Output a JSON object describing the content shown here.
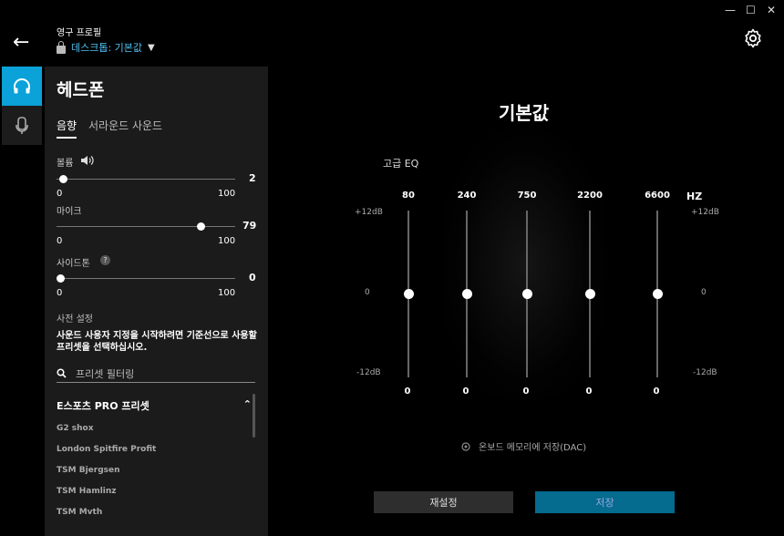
{
  "window": {
    "minimize": "—",
    "maximize": "☐",
    "close": "✕"
  },
  "header": {
    "back": "←",
    "profile_label": "영구 프로필",
    "profile_name": "데스크톱: 기본값"
  },
  "panel": {
    "title": "헤드폰",
    "tabs": [
      {
        "label": "음향",
        "active": true
      },
      {
        "label": "서라운드 사운드",
        "active": false
      }
    ],
    "sliders": [
      {
        "label": "볼륨",
        "value": "2",
        "fraction": 0.02,
        "min": "0",
        "max": "100"
      },
      {
        "label": "마이크",
        "value": "79",
        "fraction": 0.79,
        "min": "0",
        "max": "100"
      },
      {
        "label": "사이드톤",
        "value": "0",
        "fraction": 0.0,
        "min": "0",
        "max": "100",
        "help": "?"
      }
    ],
    "presets": {
      "label": "사전 설정",
      "description": "사운드 사용자 지정을 시작하려면 기준선으로 사용할 프리셋을 선택하십시오.",
      "search_placeholder": "프리셋 필터링",
      "group": "E스포츠 PRO 프리셋",
      "items": [
        "G2 shox",
        "London Spitfire Profit",
        "TSM Bjergsen",
        "TSM Hamlinz",
        "TSM Mvth"
      ]
    }
  },
  "main": {
    "title": "기본값",
    "eq": {
      "title": "고급 EQ",
      "unit": "HZ",
      "db_top": "+12dB",
      "db_mid": "0",
      "db_bot": "-12dB",
      "bands": [
        {
          "freq": "80",
          "value": "0"
        },
        {
          "freq": "240",
          "value": "0"
        },
        {
          "freq": "750",
          "value": "0"
        },
        {
          "freq": "2200",
          "value": "0"
        },
        {
          "freq": "6600",
          "value": "0"
        }
      ]
    },
    "dac_label": "온보드 메모리에 저장(DAC)",
    "reset_label": "재설정",
    "save_label": "저장"
  }
}
